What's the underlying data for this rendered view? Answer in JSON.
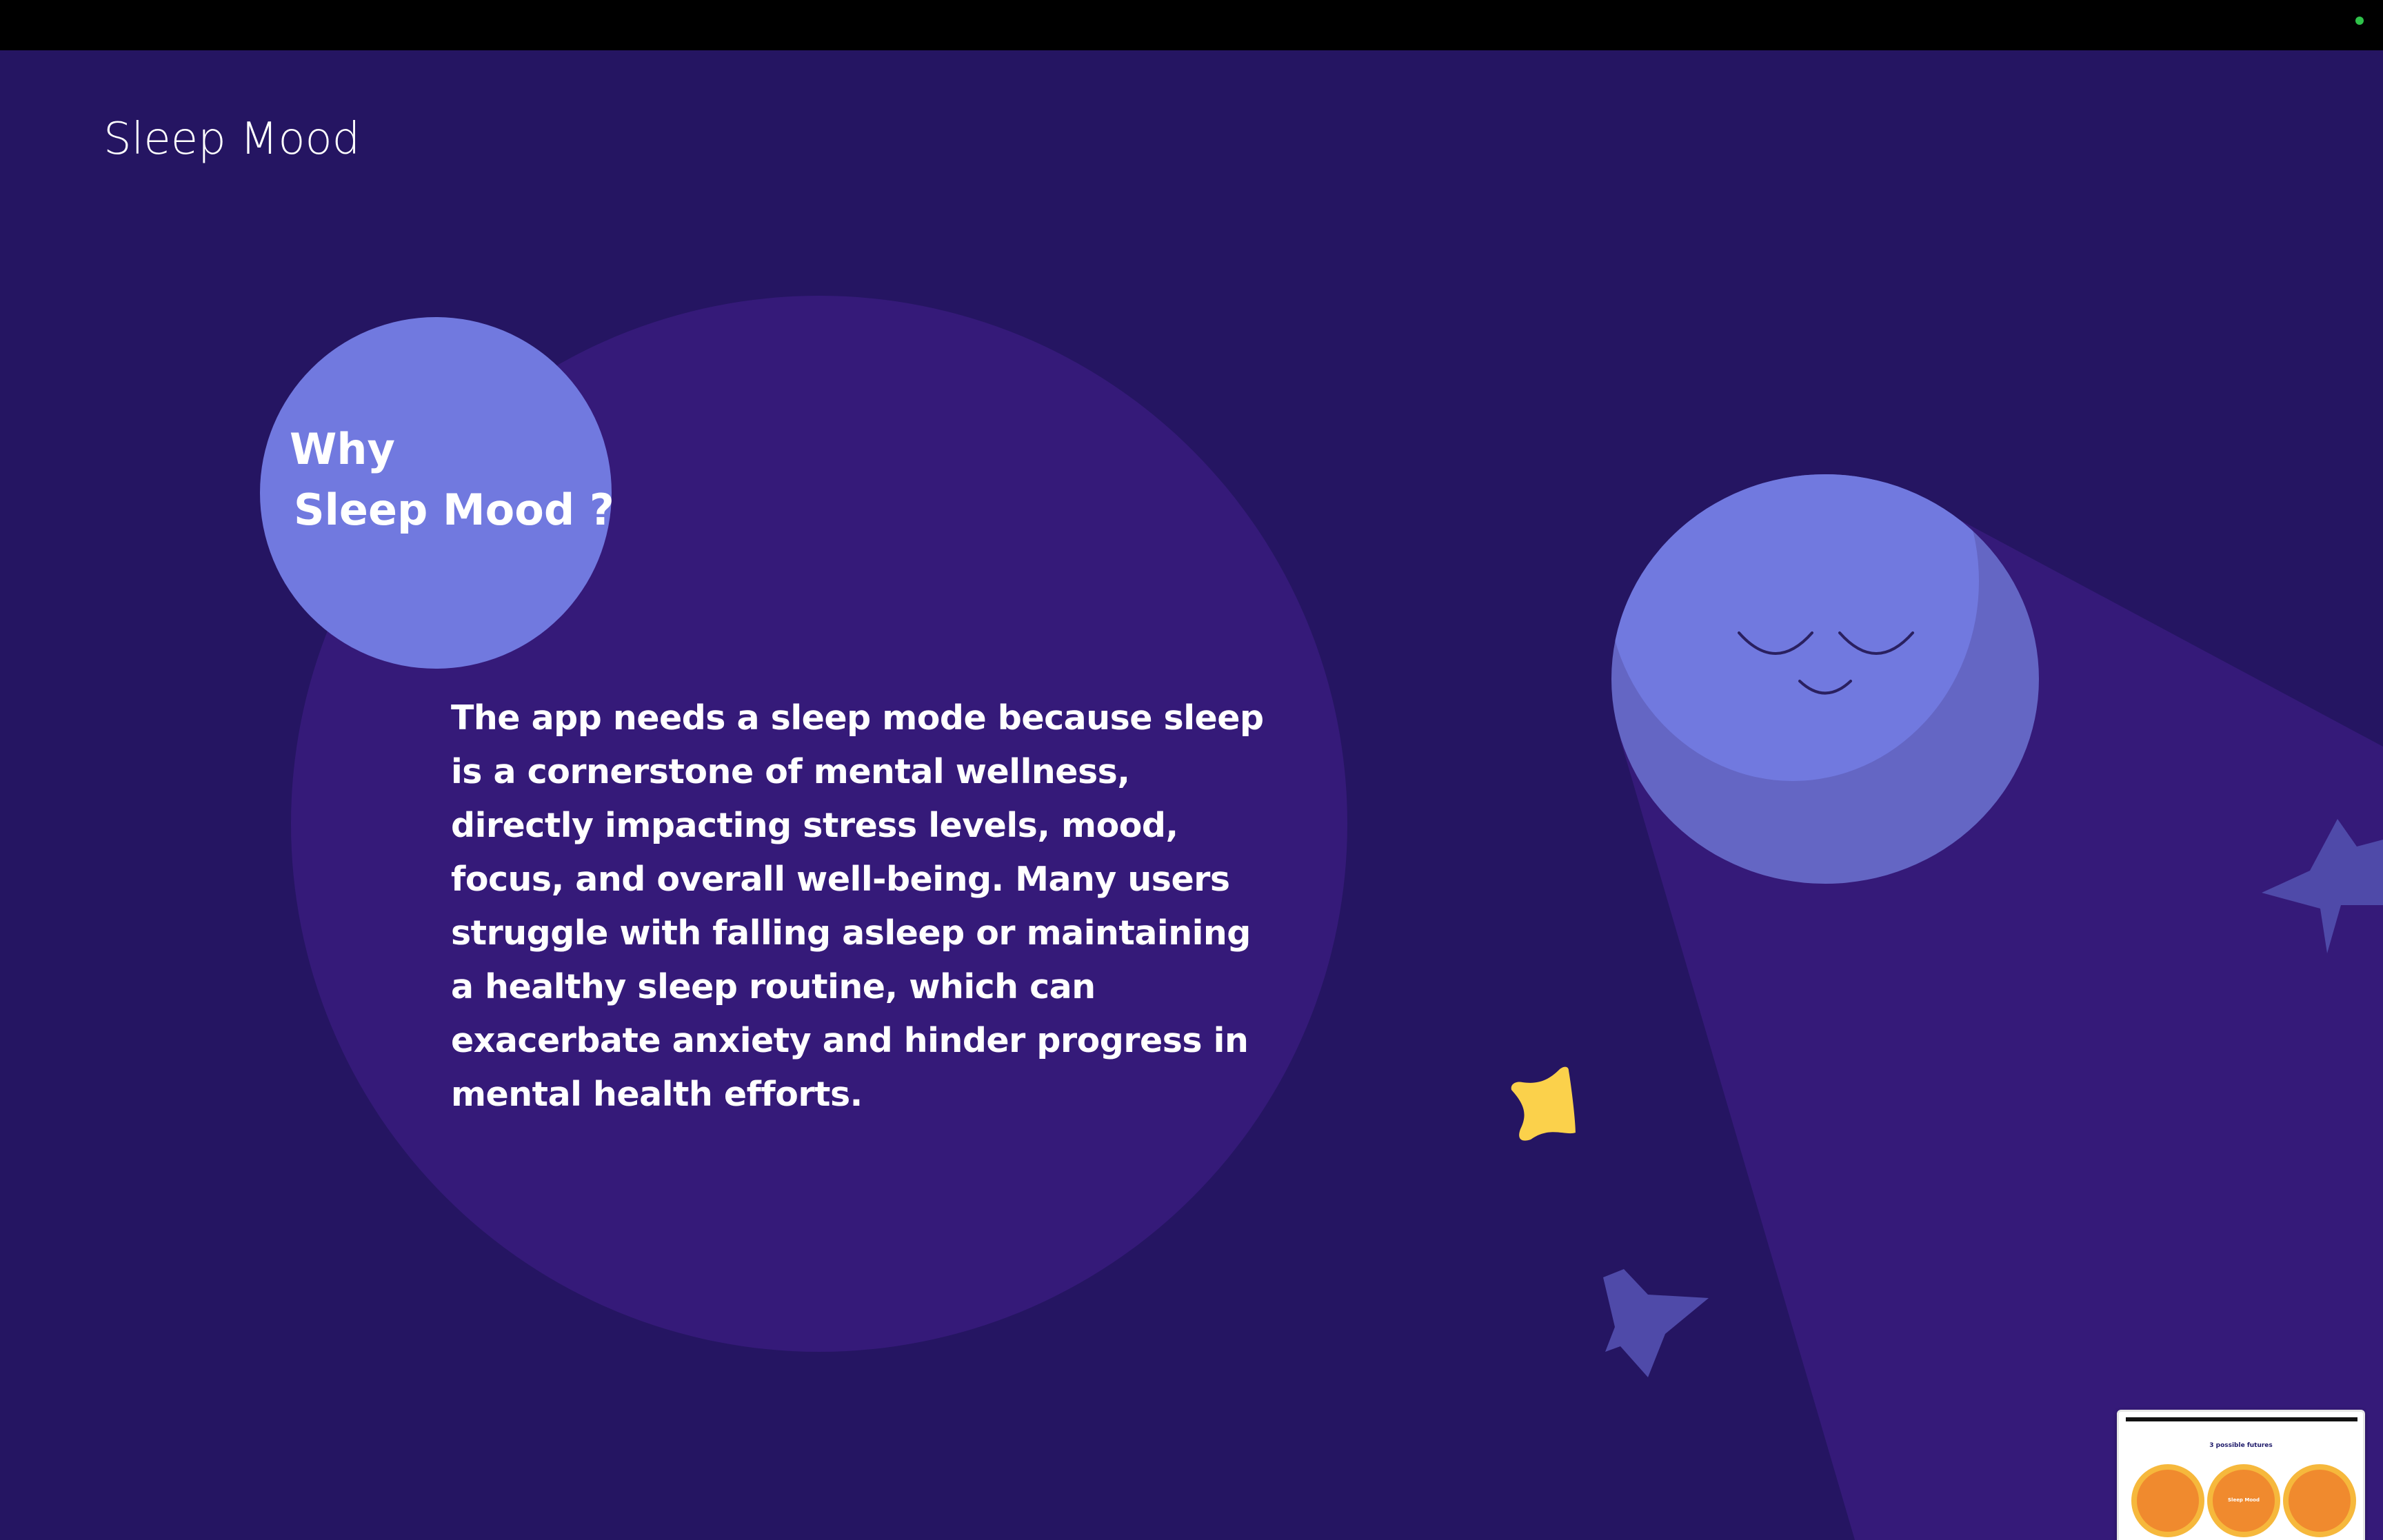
{
  "slide": {
    "title": "Sleep Mood",
    "heading_line1": "Why",
    "heading_line2": "Sleep Mood ?",
    "body": "The app needs a sleep mode because sleep is a cornerstone of mental wellness, directly impacting stress levels, mood, focus, and overall well-being. Many users struggle with falling asleep or maintaining a healthy sleep routine, which can exacerbate anxiety and hinder progress in mental health efforts."
  },
  "thumbnail": {
    "title": "3 possible futures",
    "center_label": "Sleep Mood"
  },
  "colors": {
    "background": "#251562",
    "big_circle": "#351a79",
    "accent_circle": "#7179df",
    "moon_shadow": "#6466c4",
    "beam": "#351a79",
    "star_yellow": "#fbd14b",
    "star_purple": "#4f4aa9",
    "status_dot": "#2fc24a"
  },
  "icons": {
    "moon": "sleeping-moon-icon",
    "yellow_star": "star-icon",
    "purple_star": "star-icon"
  }
}
